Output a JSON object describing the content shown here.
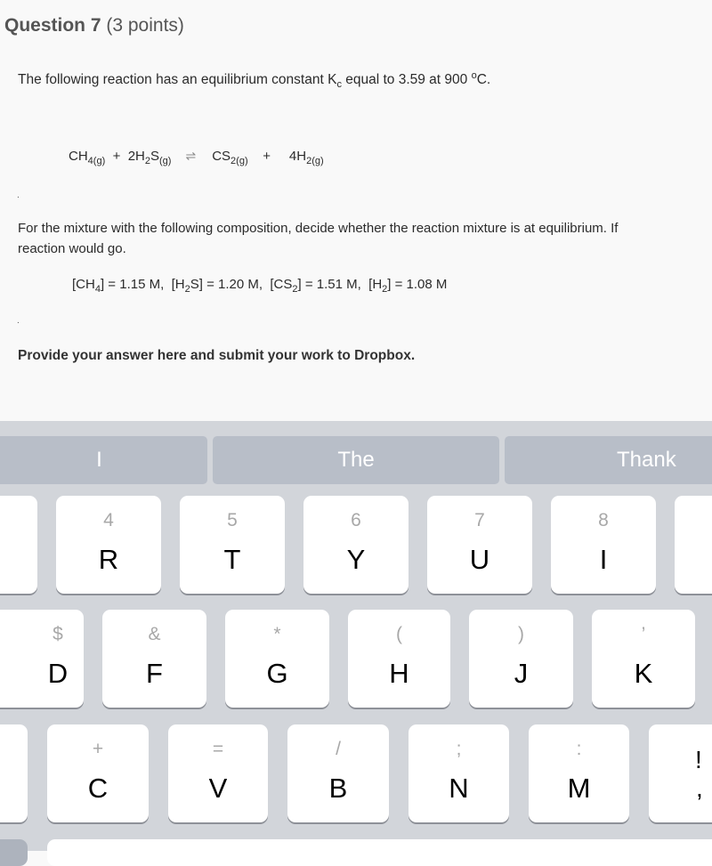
{
  "question": {
    "title": "Question 7",
    "points": "(3 points)",
    "intro": {
      "before_k": "The following reaction has an equilibrium constant K",
      "k_sub": "c",
      "after_k": " equal to 3.59 at 900 ",
      "degree_sup": "o",
      "unit_end": "C."
    },
    "equation": {
      "reactant1": "CH",
      "reactant1_sub": "4(g)",
      "plus1": "+",
      "reactant2_pre": "2H",
      "reactant2_sub1": "2",
      "reactant2_mid": "S",
      "reactant2_sub2": "(g)",
      "arrow": "⇌",
      "product1": "CS",
      "product1_sub": "2(g)",
      "plus2": "+",
      "product2": "4H",
      "product2_sub": "2(g)"
    },
    "separator_dot": ".",
    "mixture_line1": "For the mixture with the following composition, decide whether the reaction mixture is at equilibrium.  If",
    "mixture_line2": "reaction would go.",
    "concentrations": [
      {
        "open": "[CH",
        "sub": "4",
        "close": "]  = 1.15 M,"
      },
      {
        "open": "[H",
        "sub": "2",
        "close": "S] = 1.20 M,"
      },
      {
        "open": "[CS",
        "sub": "2",
        "close": "] = 1.51 M,"
      },
      {
        "open": "[H",
        "sub": "2",
        "close": "] = 1.08 M"
      }
    ],
    "provide": "Provide your answer here and submit your work to Dropbox."
  },
  "keyboard": {
    "suggestions": [
      "I",
      "The",
      "Thank"
    ],
    "row1": [
      {
        "alt": "",
        "main": ""
      },
      {
        "alt": "4",
        "main": "R"
      },
      {
        "alt": "5",
        "main": "T"
      },
      {
        "alt": "6",
        "main": "Y"
      },
      {
        "alt": "7",
        "main": "U"
      },
      {
        "alt": "8",
        "main": "I"
      },
      {
        "alt": "",
        "main": ""
      }
    ],
    "row2": [
      {
        "alt": "$",
        "main": "D"
      },
      {
        "alt": "&",
        "main": "F"
      },
      {
        "alt": "*",
        "main": "G"
      },
      {
        "alt": "(",
        "main": "H"
      },
      {
        "alt": ")",
        "main": "J"
      },
      {
        "alt": "’",
        "main": "K"
      }
    ],
    "row3": [
      {
        "alt": "",
        "main": ""
      },
      {
        "alt": "+",
        "main": "C"
      },
      {
        "alt": "=",
        "main": "V"
      },
      {
        "alt": "/",
        "main": "B"
      },
      {
        "alt": ";",
        "main": "N"
      },
      {
        "alt": ":",
        "main": "M"
      },
      {
        "alt": "!",
        "main": ","
      }
    ]
  }
}
